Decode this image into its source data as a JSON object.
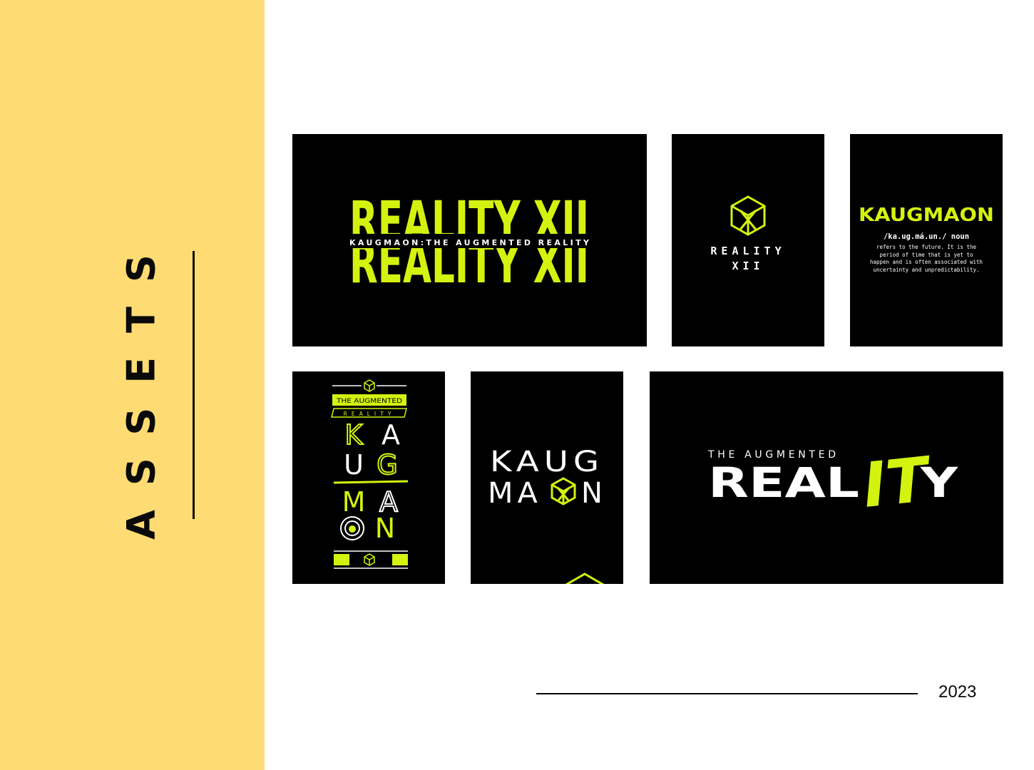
{
  "sidebar": {
    "title": "ASSETS",
    "bg_color": "#fedc73"
  },
  "accent_color": "#d4f20f",
  "cards": {
    "reality_banner": {
      "big_text": "REALITY XII",
      "subtitle": "KAUGMAON:THE AUGMENTED REALITY"
    },
    "reality_logo": {
      "line1": "REALITY",
      "line2": "XII",
      "icon": "hexagon-cube-icon"
    },
    "definition": {
      "word": "KAUGMAON",
      "pronunciation": "/ka.ug.má.un./ noun",
      "lines": [
        "refers to the future. It is the",
        "period of time that is yet to",
        "happen and is often associated with",
        "uncertainty and unpredictability."
      ]
    },
    "poster": {
      "tag1": "THE AUGMENTED",
      "tag2": "REALITY",
      "letters": [
        "K",
        "A",
        "U",
        "G",
        "M",
        "A",
        "N"
      ],
      "icon": "hexagon-cube-icon"
    },
    "kaugmaon_logo": {
      "line1": "KAUG",
      "line2a": "MA",
      "line2b": "N",
      "icon": "hexagon-cube-icon"
    },
    "augmented_banner": {
      "small": "THE AUGMENTED",
      "big": "REAL",
      "script": "IT",
      "end": "Y"
    }
  },
  "footer": {
    "year": "2023"
  }
}
